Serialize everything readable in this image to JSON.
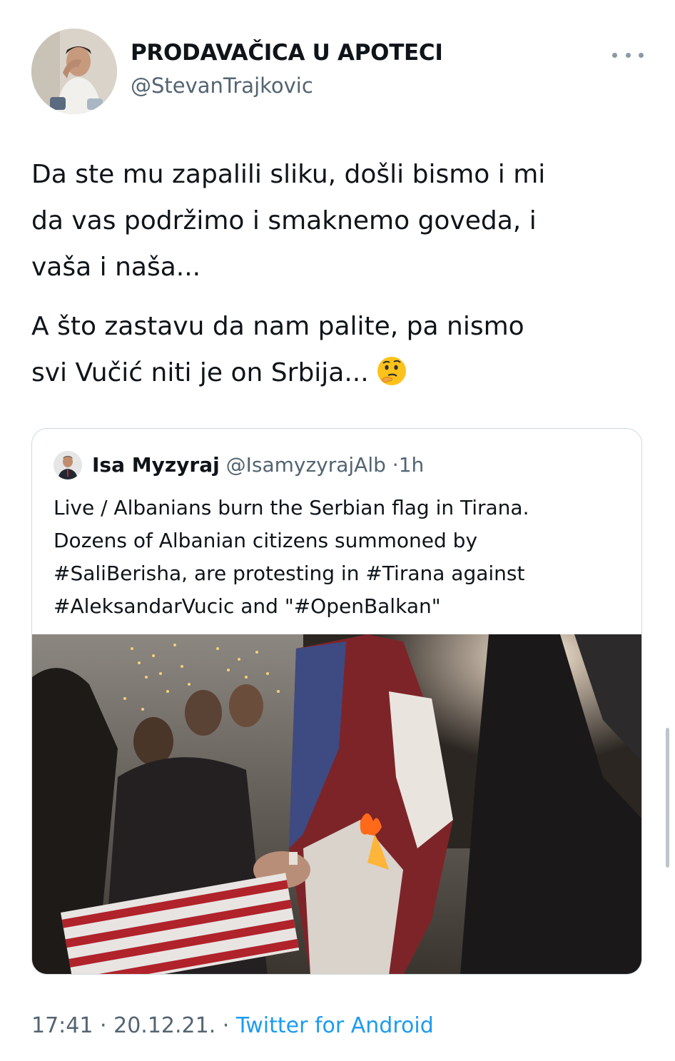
{
  "tweet": {
    "display_name": "PRODAVAČICA U APOTECI",
    "handle": "@StevanTrajkovic",
    "more_icon": "more-horizontal-icon",
    "text_paragraph_1": "Da ste mu zapalili sliku, došli bismo i mi\nda vas podržimo i smaknemo goveda, i\nvaša i naša...",
    "text_paragraph_2": "A što zastavu da nam palite, pa nismo\nsvi Vučić niti je on Srbija...",
    "emoji": "thinking-face-emoji"
  },
  "quoted_tweet": {
    "display_name": "Isa Myzyraj",
    "handle": "@IsamyzyrajAlb",
    "separator": "·",
    "time": "1h",
    "text": "Live / Albanians burn the Serbian flag in Tirana.\nDozens of Albanian citizens summoned by\n#SaliBerisha, are protesting in #Tirana against\n#AleksandarVucic and \"#OpenBalkan\"",
    "media": "protest-flag-burning-photo"
  },
  "footer": {
    "time": "17:41",
    "separator_1": "·",
    "date": "20.12.21.",
    "separator_2": "·",
    "source": "Twitter for Android"
  },
  "colors": {
    "text_primary": "#0f1419",
    "text_secondary": "#536471",
    "link": "#1d9bf0",
    "border": "#cfd9de"
  }
}
